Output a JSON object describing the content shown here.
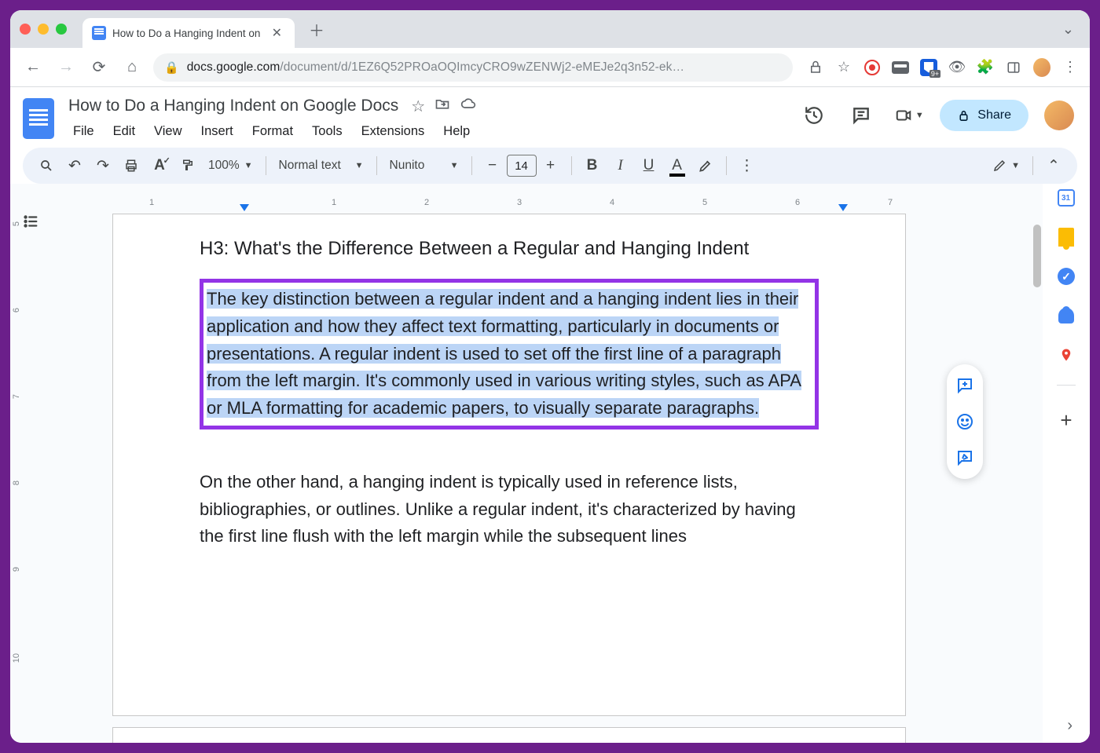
{
  "browser": {
    "tab_title": "How to Do a Hanging Indent on",
    "url_host": "docs.google.com",
    "url_path": "/document/d/1EZ6Q52PROaOQImcyCRO9wZENWj2-eMEJe2q3n52-ek…",
    "bitwarden_badge": "9+"
  },
  "docs": {
    "title": "How to Do a Hanging Indent on Google Docs",
    "menus": [
      "File",
      "Edit",
      "View",
      "Insert",
      "Format",
      "Tools",
      "Extensions",
      "Help"
    ],
    "share_label": "Share"
  },
  "toolbar": {
    "zoom": "100%",
    "style": "Normal text",
    "font": "Nunito",
    "font_minus": "−",
    "font_size": "14",
    "font_plus": "+"
  },
  "ruler": {
    "h": [
      "1",
      "2",
      "3",
      "4",
      "5",
      "6",
      "7"
    ],
    "h_leading": "1",
    "v": [
      "5",
      "6",
      "7",
      "8",
      "9",
      "10"
    ]
  },
  "content": {
    "heading": "H3: What's the Difference Between a Regular and Hanging Indent",
    "para1": "The key distinction between a regular indent and a hanging indent lies in their application and how they affect text formatting, particularly in documents or presentations. A regular indent is used to set off the first line of a paragraph from the left margin. It's commonly used in various writing styles, such as APA or MLA formatting for academic papers, to visually separate paragraphs.",
    "para2": "On the other hand, a hanging indent is typically used in reference lists, bibliographies, or outlines. Unlike a regular indent, it's characterized by having the first line flush with the left margin while the subsequent lines"
  }
}
